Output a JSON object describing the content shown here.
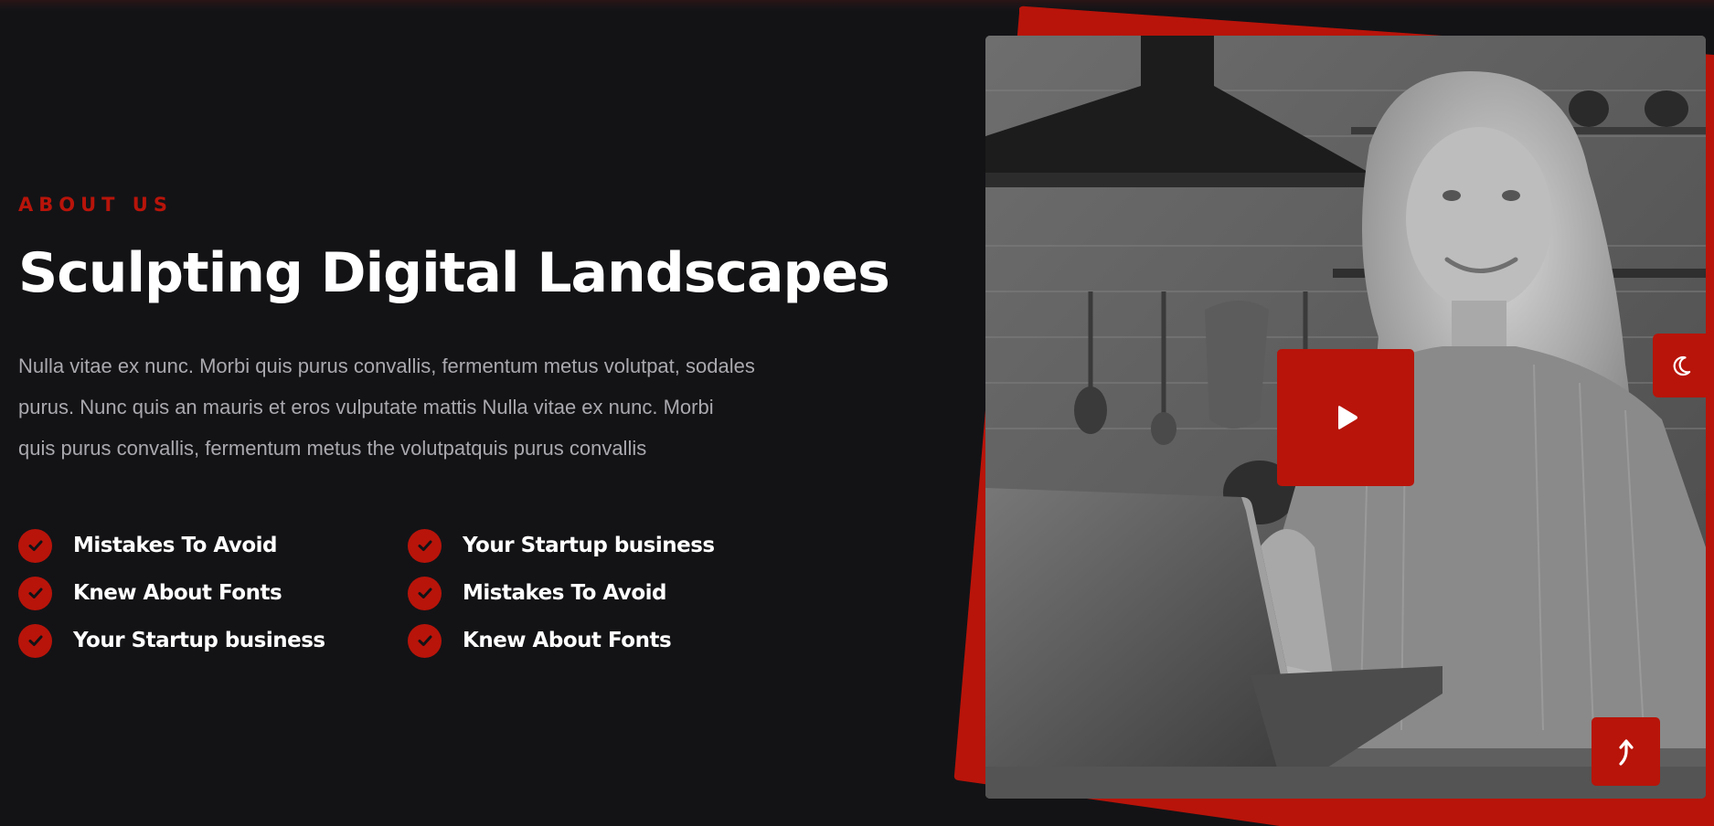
{
  "about": {
    "eyebrow": "ABOUT US",
    "headline": "Sculpting Digital Landscapes",
    "paragraph_lines": [
      "Nulla vitae ex nunc. Morbi quis purus convallis, fermentum metus volutpat, sodales",
      "purus. Nunc quis an mauris et eros vulputate mattis Nulla vitae ex nunc. Morbi",
      "quis purus convallis, fermentum metus the volutpatquis purus convallis"
    ]
  },
  "features": {
    "left": [
      "Mistakes To Avoid",
      "Knew About Fonts",
      "Your Startup business"
    ],
    "right": [
      "Your Startup business",
      "Mistakes To Avoid",
      "Knew About Fonts"
    ]
  },
  "media": {
    "play_icon": "play-icon",
    "theme_icon": "moon-icon",
    "scroll_icon": "arrow-up-icon"
  },
  "colors": {
    "background": "#131316",
    "accent": "#b8140a",
    "text_primary": "#ffffff",
    "text_muted": "#a9a9ae"
  }
}
